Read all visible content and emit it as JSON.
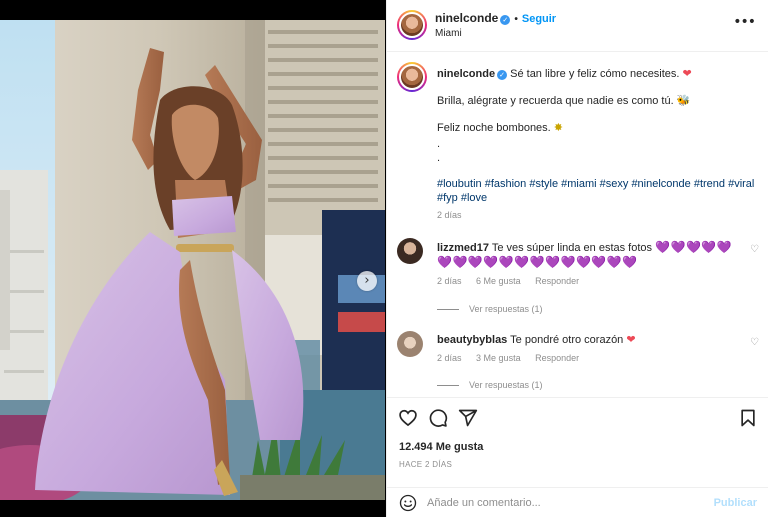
{
  "header": {
    "username": "ninelconde",
    "verified_glyph": "✓",
    "bullet": "•",
    "follow_label": "Seguir",
    "location": "Miami",
    "more_icon": "•••"
  },
  "media": {
    "next_glyph": "›",
    "slide_count": 2,
    "active_slide": 1
  },
  "caption": {
    "username": "ninelconde",
    "line1": "Sé tan libre y feliz cómo necesites.",
    "line1_emoji": "❤",
    "line2": "Brilla, alégrate y recuerda que nadie es como tú.",
    "line2_emoji": "🐝",
    "line3": "Feliz noche bombones.",
    "line3_emoji": "✸",
    "dot1": ".",
    "dot2": ".",
    "hashtags": "#loubutin #fashion #style #miami #sexy #ninelconde #trend #viral #fyp #love",
    "time": "2 días"
  },
  "comments": [
    {
      "username": "lizzmed17",
      "text": "Te ves súper linda en estas fotos",
      "hearts": "💜💜💜💜💜",
      "hearts_line2": "💜💜💜💜💜💜💜💜💜💜💜💜💜",
      "time": "2 días",
      "likes": "6 Me gusta",
      "reply_label": "Responder",
      "view_replies": "Ver respuestas (1)"
    },
    {
      "username": "beautybyblas",
      "text": "Te pondré otro corazón",
      "hearts": "❤",
      "time": "2 días",
      "likes": "3 Me gusta",
      "reply_label": "Responder",
      "view_replies": "Ver respuestas (1)"
    }
  ],
  "icons": {
    "comment_like": "♡",
    "like": "heart-icon",
    "comment": "comment-icon",
    "share": "share-icon",
    "save": "bookmark-icon",
    "emoji": "smile-icon"
  },
  "stats": {
    "likes": "12.494 Me gusta",
    "posted_ago": "HACE 2 DÍAS"
  },
  "add_comment": {
    "placeholder": "Añade un comentario...",
    "publish_label": "Publicar"
  },
  "colors": {
    "accent_blue": "#0095f6",
    "verified_blue": "#3897f0",
    "heart_red": "#ed4956",
    "hashtag": "#00376b",
    "muted": "#8e8e8e",
    "publish_disabled": "#b2dffc"
  }
}
